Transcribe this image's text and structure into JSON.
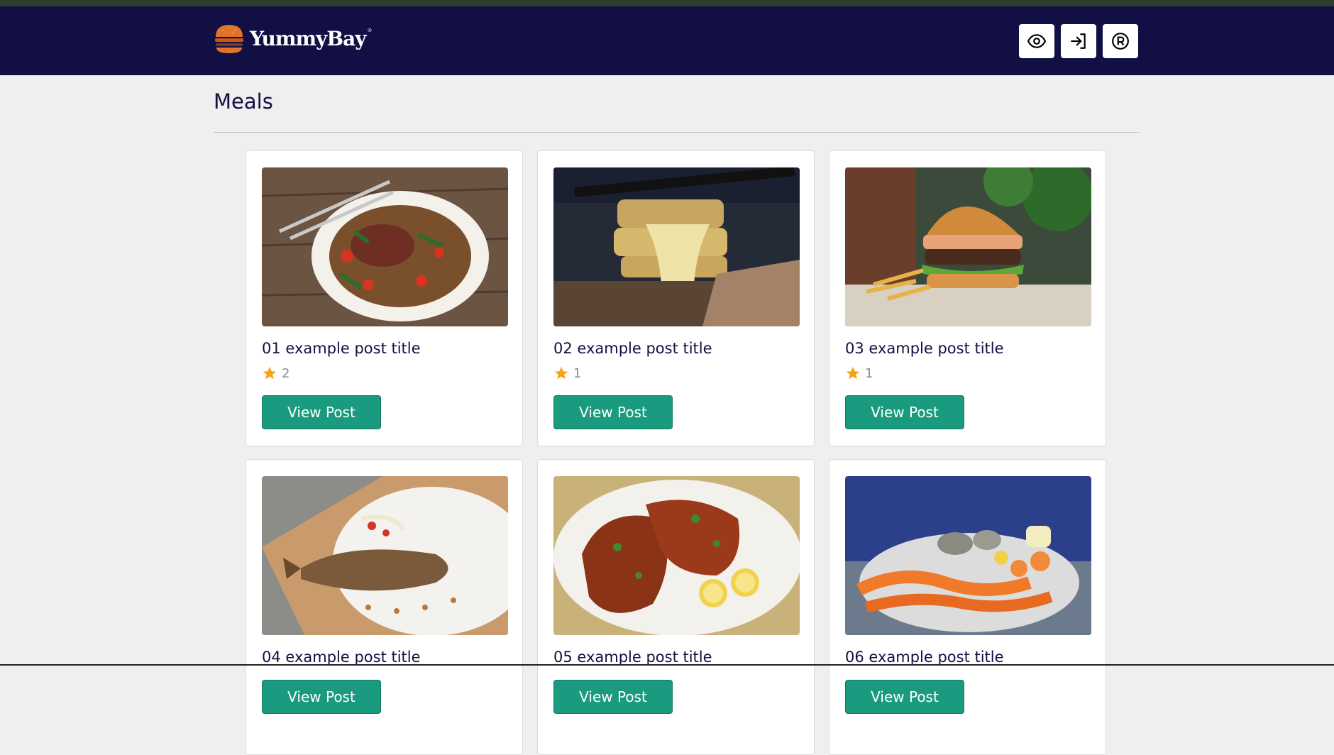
{
  "brand": {
    "name": "YummyBay",
    "reg": "®"
  },
  "nav": {
    "items": [
      {
        "icon": "eye-icon"
      },
      {
        "icon": "login-icon"
      },
      {
        "icon": "registered-icon"
      }
    ]
  },
  "page": {
    "title": "Meals"
  },
  "colors": {
    "header": "#120f45",
    "accent": "#1a9a7e",
    "star": "#f5a313"
  },
  "posts": [
    {
      "title": "01 example post title",
      "rating": "2",
      "button": "View Post"
    },
    {
      "title": "02 example post title",
      "rating": "1",
      "button": "View Post"
    },
    {
      "title": "03 example post title",
      "rating": "1",
      "button": "View Post"
    },
    {
      "title": "04 example post title",
      "rating": "",
      "button": "View Post"
    },
    {
      "title": "05 example post title",
      "rating": "",
      "button": "View Post"
    },
    {
      "title": "06 example post title",
      "rating": "",
      "button": "View Post"
    }
  ]
}
